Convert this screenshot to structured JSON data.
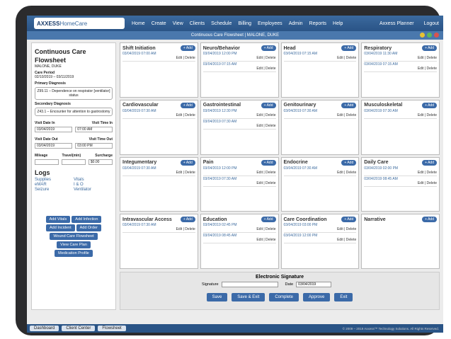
{
  "logo": {
    "bold": "AXXESS",
    "thin": "HomeCare"
  },
  "nav": [
    "Home",
    "Create",
    "View",
    "Clients",
    "Schedule",
    "Billing",
    "Employees",
    "Admin",
    "Reports",
    "Help"
  ],
  "right_nav": [
    "Axxess Planner",
    "Logout"
  ],
  "subtitle": "Continuous Care Flowsheet | MALONE, DUKE",
  "left": {
    "title": "Continuous Care Flowsheet",
    "patient": "MALONE, DUKE",
    "care_period_label": "Care Period",
    "care_period": "02/10/2019 – 03/11/2019",
    "primary_label": "Primary Diagnosis",
    "primary": "Z99.11 – Dependence on respirator [ventilator] status",
    "secondary_label": "Secondary Diagnosis",
    "secondary": "Z43.1 – Encounter for attention to gastrostomy",
    "visit_date_in_label": "Visit Date In",
    "visit_time_in_label": "Visit Time In",
    "visit_date_in": "03/04/2019",
    "visit_time_in": "07:00 AM",
    "visit_date_out_label": "Visit Date Out",
    "visit_time_out_label": "Visit Time Out",
    "visit_date_out": "03/04/2019",
    "visit_time_out": "03:00 PM",
    "mileage_label": "Mileage",
    "travel_label": "Travel(min)",
    "surcharge_label": "Surcharge",
    "surcharge": "$0.00",
    "logs_title": "Logs",
    "logs": [
      "Supplies",
      "Vitals",
      "eMAR",
      "I & O",
      "Seizure",
      "Ventilator"
    ],
    "buttons": [
      "Add Vitals",
      "Add Infection",
      "Add Incident",
      "Add Order",
      "Wound Care Flowsheet",
      "View Care Plan",
      "Medication Profile"
    ]
  },
  "add_label": "+ Add",
  "edit_label": "Edit",
  "delete_label": "Delete",
  "cards": [
    {
      "title": "Shift Initiation",
      "entries": [
        "03/04/2019 07:00 AM"
      ]
    },
    {
      "title": "Neuro/Behavior",
      "entries": [
        "03/04/2019 12:00 PM",
        "03/04/2019 07:15 AM"
      ]
    },
    {
      "title": "Head",
      "entries": [
        "03/04/2019 07:15 AM"
      ]
    },
    {
      "title": "Respiratory",
      "entries": [
        "03/04/2019 11:30 AM",
        "03/04/2019 07:15 AM"
      ]
    },
    {
      "title": "Cardiovascular",
      "entries": [
        "03/04/2019 07:30 AM"
      ]
    },
    {
      "title": "Gastrointestinal",
      "entries": [
        "03/04/2019 12:30 PM",
        "03/04/2019 07:30 AM"
      ]
    },
    {
      "title": "Genitourinary",
      "entries": [
        "03/04/2019 07:30 AM"
      ]
    },
    {
      "title": "Musculoskeletal",
      "entries": [
        "03/04/2019 07:30 AM"
      ]
    },
    {
      "title": "Integumentary",
      "entries": [
        "03/04/2019 07:30 AM"
      ]
    },
    {
      "title": "Pain",
      "entries": [
        "03/04/2019 12:00 PM",
        "03/04/2019 07:30 AM"
      ]
    },
    {
      "title": "Endocrine",
      "entries": [
        "03/04/2019 07:30 AM"
      ]
    },
    {
      "title": "Daily Care",
      "entries": [
        "03/04/2019 02:00 PM",
        "03/04/2019 08:45 AM"
      ]
    },
    {
      "title": "Intravascular Access",
      "entries": [
        "03/04/2019 07:30 AM"
      ]
    },
    {
      "title": "Education",
      "entries": [
        "03/04/2019 02:45 PM",
        "03/04/2019 08:45 AM"
      ]
    },
    {
      "title": "Care Coordination",
      "entries": [
        "03/04/2019 03:00 PM",
        "03/04/2019 12:00 PM"
      ]
    },
    {
      "title": "Narrative",
      "entries": []
    }
  ],
  "esig": {
    "title": "Electronic Signature",
    "sig_label": "Signature",
    "date_label": "Date",
    "date": "03/04/2019"
  },
  "actions": [
    "Save",
    "Save & Exit",
    "Complete",
    "Approve",
    "Exit"
  ],
  "tabs": [
    "Dashboard",
    "Client Center",
    "Flowsheet"
  ],
  "copyright": "© 2009 – 2019 Axxess™ Technology Solutions. All Rights Reserved."
}
